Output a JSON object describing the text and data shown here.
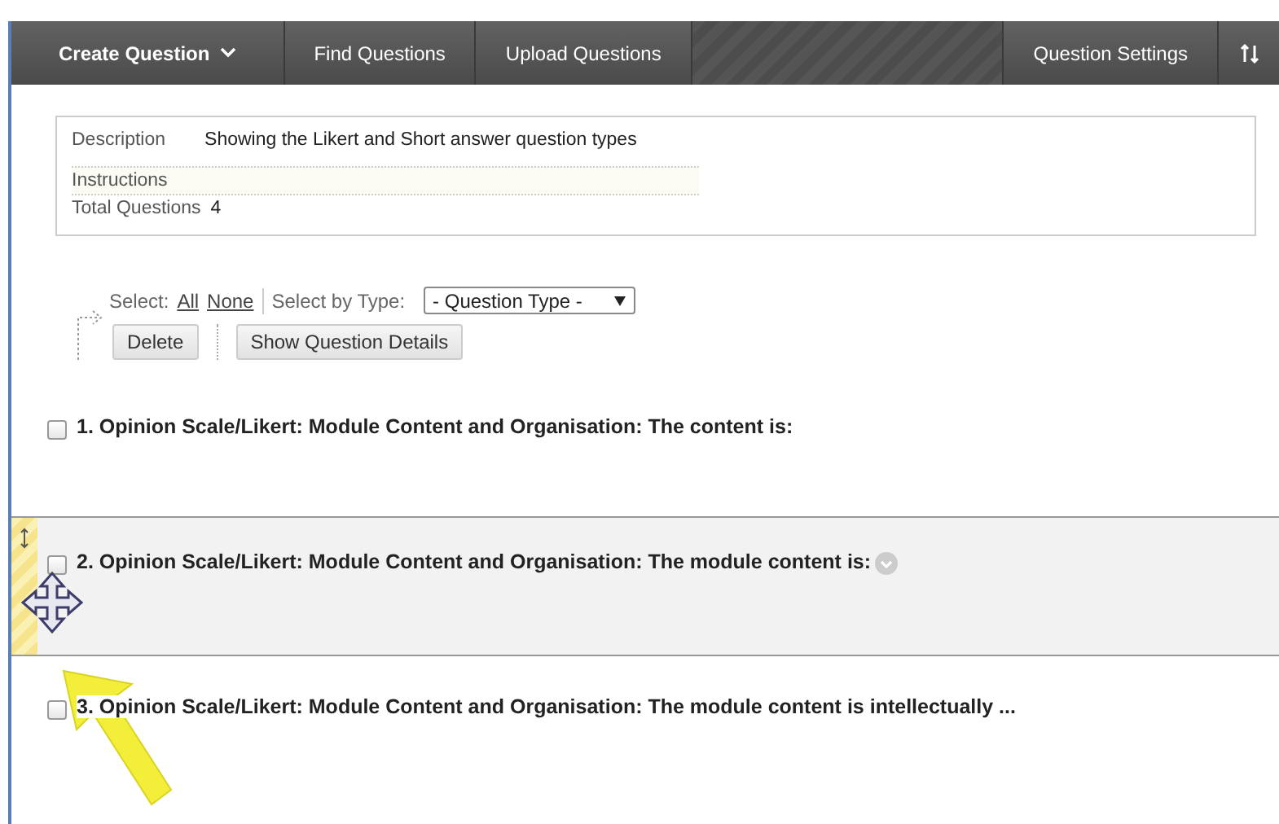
{
  "toolbar": {
    "items": [
      {
        "kind": "menu",
        "label": "Create Question"
      },
      {
        "kind": "button",
        "label": "Find Questions"
      },
      {
        "kind": "button",
        "label": "Upload Questions"
      },
      {
        "kind": "spacer"
      },
      {
        "kind": "button",
        "label": "Question Settings"
      },
      {
        "kind": "sort"
      }
    ]
  },
  "details": [
    {
      "label": "Description",
      "value": "Showing the Likert and Short answer question types"
    },
    {
      "label": "Instructions"
    },
    {
      "label": "Total Questions",
      "value": "4"
    }
  ],
  "selection": {
    "select_label": "Select:",
    "all": "All",
    "none": "None",
    "by_type_label": "Select by Type:",
    "type_dropdown": "- Question Type -"
  },
  "actions": [
    "Delete",
    "Show Question Details"
  ],
  "questions": [
    {
      "title": "1. Opinion Scale/Likert: Module Content and Organisation: The content is:",
      "checked": false,
      "dragging": false
    },
    {
      "title": "2. Opinion Scale/Likert: Module Content and Organisation: The module content is:",
      "checked": false,
      "dragging": true
    },
    {
      "title": "3. Opinion Scale/Likert: Module Content and Organisation: The module content is intellectually ...",
      "checked": false,
      "dragging": false
    }
  ]
}
